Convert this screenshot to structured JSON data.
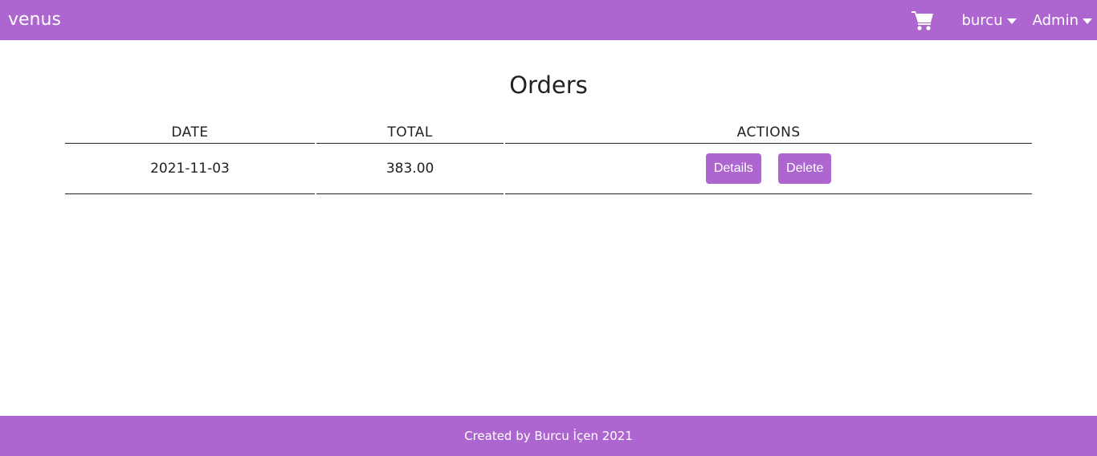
{
  "navbar": {
    "brand": "venus",
    "cart_icon": "shopping-cart-icon",
    "user_menu_label": "burcu",
    "admin_menu_label": "Admin"
  },
  "page": {
    "title": "Orders"
  },
  "table": {
    "headers": [
      "DATE",
      "TOTAL",
      "ACTIONS"
    ],
    "rows": [
      {
        "date": "2021-11-03",
        "total": "383.00",
        "details_label": "Details",
        "delete_label": "Delete"
      }
    ]
  },
  "footer": {
    "text": "Created by Burcu İçen 2021"
  },
  "colors": {
    "accent": "#ad66cf"
  }
}
